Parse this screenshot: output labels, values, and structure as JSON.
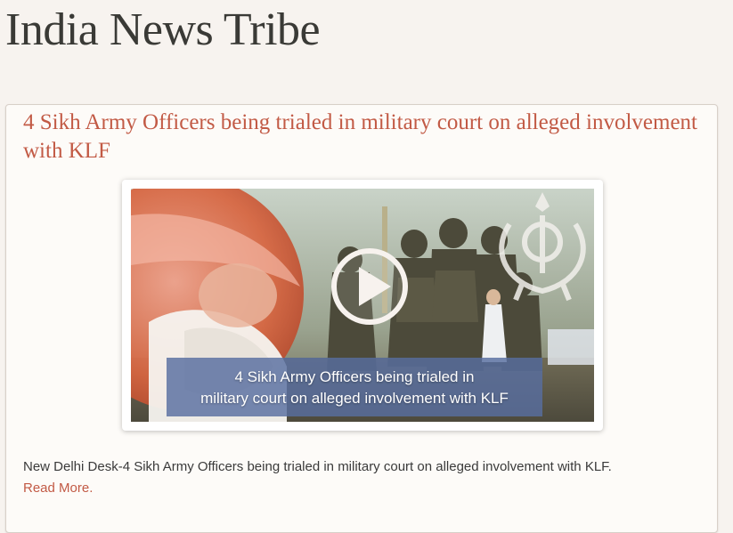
{
  "site": {
    "title": "India News Tribe"
  },
  "post": {
    "title": "4 Sikh Army Officers being trialed in military court on alleged involvement with KLF",
    "video": {
      "caption_line1": "4 Sikh Army Officers being trialed in",
      "caption_line2": "military court on alleged involvement with KLF",
      "icons": [
        "play-button-icon",
        "khanda-icon"
      ]
    },
    "excerpt": "New Delhi Desk-4 Sikh Army Officers being trialed in   military court on alleged involvement with KLF.",
    "read_more": "Read More."
  },
  "colors": {
    "page_background": "#f7f3ef",
    "title_text": "#3a3a36",
    "accent": "#c25a45",
    "caption_band": "#586ea0"
  }
}
